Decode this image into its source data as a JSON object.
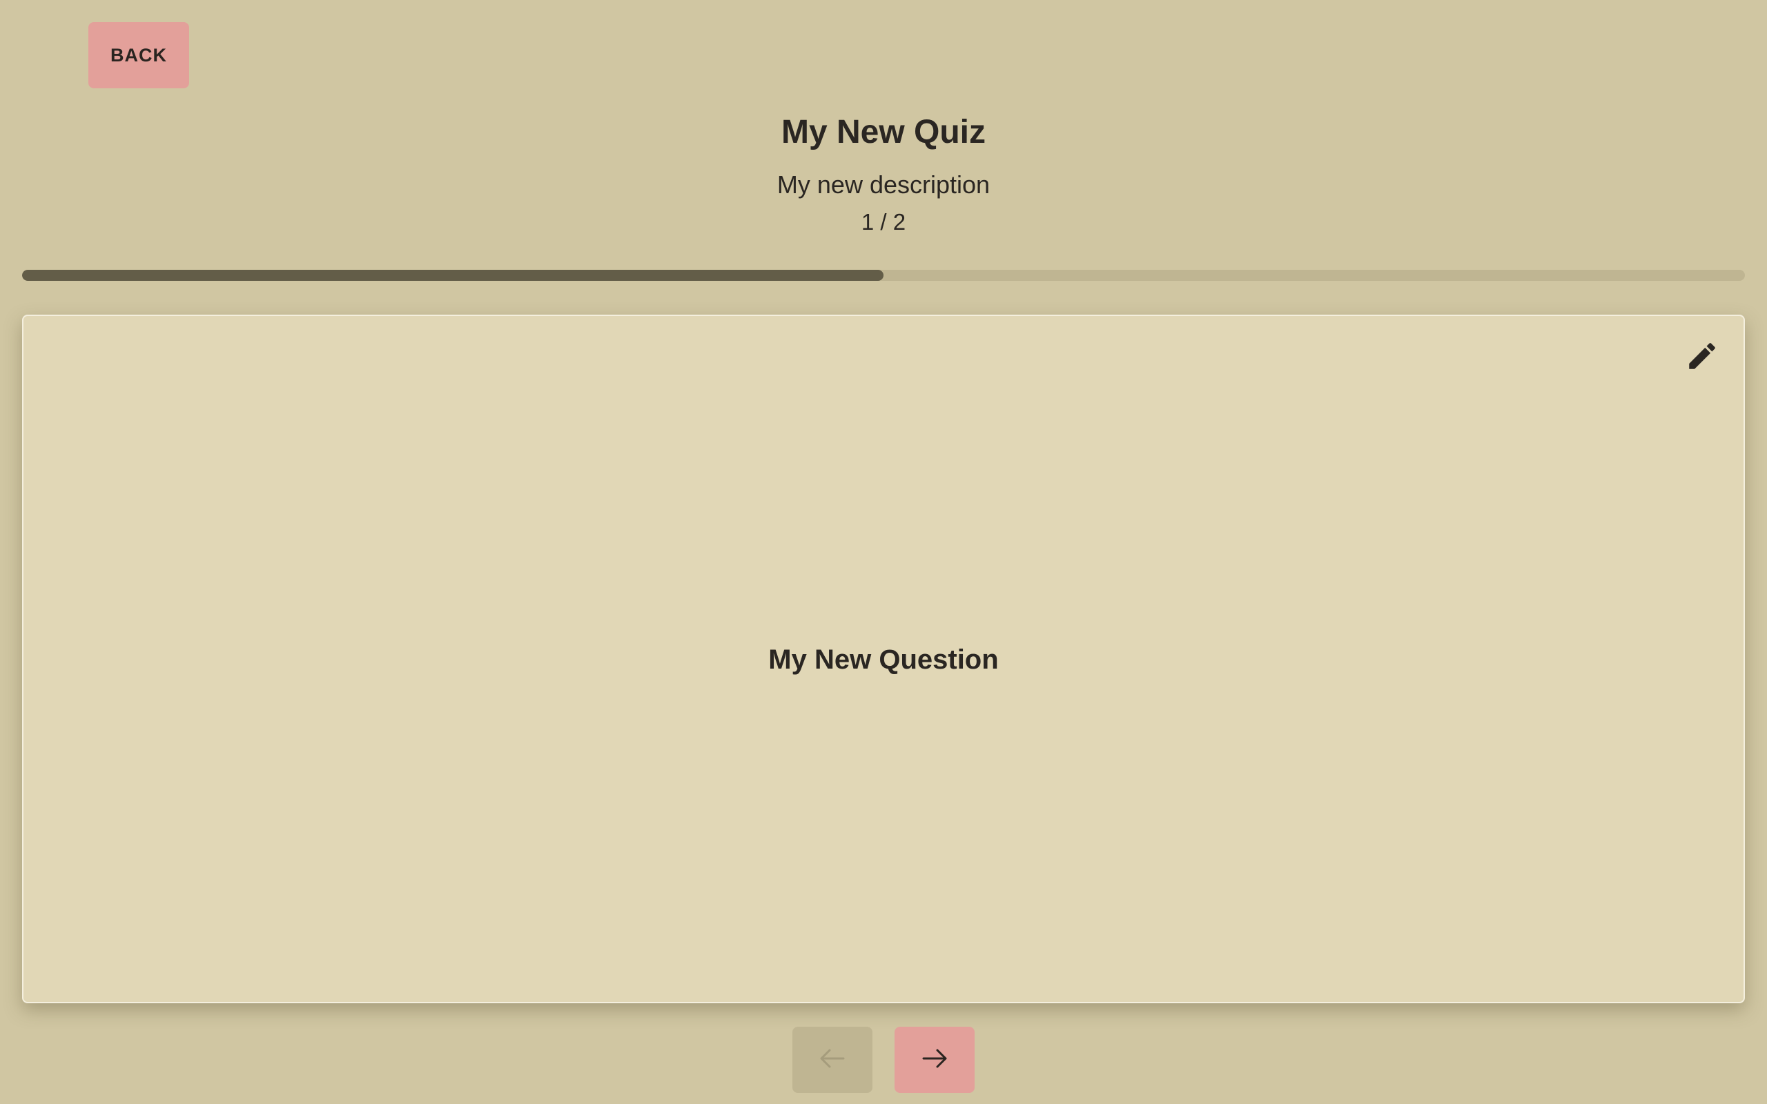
{
  "toolbar": {
    "back_label": "BACK"
  },
  "quiz": {
    "title": "My New Quiz",
    "description": "My new description",
    "counter": "1 / 2",
    "progress_fraction": 0.5
  },
  "question": {
    "text": "My New Question"
  },
  "navigation": {
    "previous_icon": "arrow-left-icon",
    "next_icon": "arrow-right-icon",
    "previous_enabled": false,
    "next_enabled": true
  },
  "icons": {
    "edit": "pencil-icon"
  },
  "colors": {
    "background": "#d0c6a2",
    "card": "#e1d7b6",
    "accent_button": "#e3a09a",
    "disabled_button": "#bfb592",
    "progress_fill": "#635d48",
    "progress_track": "#bfb592",
    "text": "#2a2622"
  }
}
